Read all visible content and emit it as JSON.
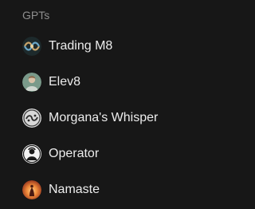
{
  "sidebar": {
    "section_title": "GPTs",
    "items": [
      {
        "label": "Trading M8",
        "icon": "trading-m8-avatar-icon"
      },
      {
        "label": "Elev8",
        "icon": "elev8-avatar-icon"
      },
      {
        "label": "Morgana's Whisper",
        "icon": "morganas-whisper-avatar-icon"
      },
      {
        "label": "Operator",
        "icon": "operator-avatar-icon"
      },
      {
        "label": "Namaste",
        "icon": "namaste-avatar-icon"
      }
    ]
  }
}
